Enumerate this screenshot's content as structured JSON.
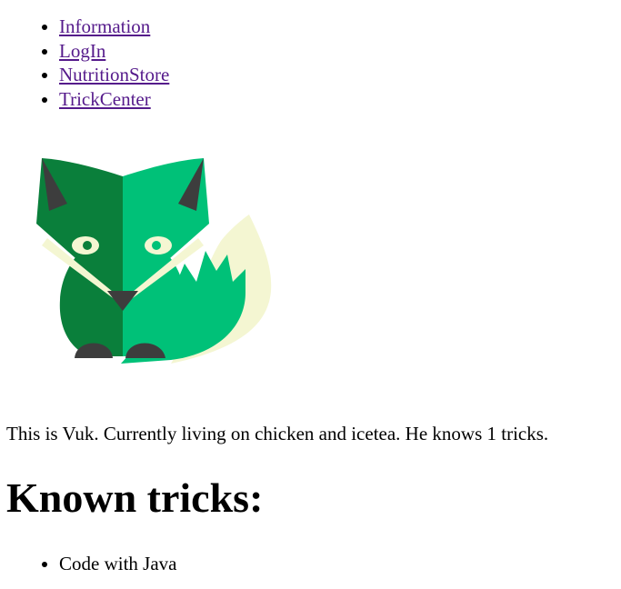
{
  "nav": {
    "items": [
      {
        "label": "Information"
      },
      {
        "label": "LogIn"
      },
      {
        "label": "NutritionStore"
      },
      {
        "label": "TrickCenter"
      }
    ]
  },
  "colors": {
    "link": "#551a8b",
    "fox_dark_green": "#0a7f3b",
    "fox_light_green": "#00c178",
    "fox_cream": "#f4f6d2",
    "fox_gray": "#3d3d3d"
  },
  "fox_image": {
    "icon": "fox-icon"
  },
  "status": {
    "text": "This is Vuk. Currently living on chicken and icetea. He knows 1 tricks."
  },
  "tricks": {
    "heading": "Known tricks:",
    "items": [
      {
        "label": "Code with Java"
      }
    ]
  }
}
